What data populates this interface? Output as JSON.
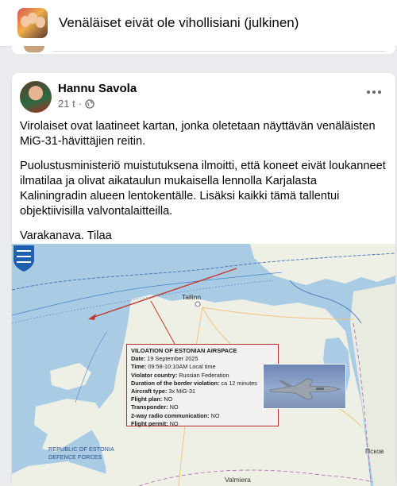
{
  "group": {
    "title": "Venäläiset eivät ole vihollisiani (julkinen)"
  },
  "post": {
    "author": "Hannu Savola",
    "time": "21 t",
    "visibility_separator": "·",
    "paragraphs": [
      "Virolaiset ovat laatineet kartan, jonka oletetaan näyttävän venäläisten MiG-31-hävittäjien reitin.",
      "Puolustusministeriö muistutuksena ilmoitti, että koneet eivät loukanneet ilmatilaa ja olivat aikataulun mukaisella lennolla Karjalasta Kaliningradin alueen lentokentälle. Lisäksi kaikki tämä tallentui objektiivisilla valvontalaitteilla.",
      "Varakanava. Tilaa"
    ]
  },
  "map": {
    "box": {
      "title": "VILOATION OF ESTONIAN AIRSPACE",
      "rows": [
        {
          "label": "Date:",
          "value": " 19 September 2025"
        },
        {
          "label": "Time:",
          "value": " 09:58-10:10AM Local time"
        },
        {
          "label": "Violator country:",
          "value": " Russian Federation"
        },
        {
          "label": "Duration of the border violation:",
          "value": " ca 12 minutes"
        },
        {
          "label": "Aircraft type:",
          "value": " 3x MiG-31"
        },
        {
          "label": "Flight plan:",
          "value": " NO"
        },
        {
          "label": "Transponder:",
          "value": " NO"
        },
        {
          "label": "2-way radio communication:",
          "value": " NO"
        },
        {
          "label": "Flight permit:",
          "value": " NO"
        }
      ]
    },
    "places": {
      "tallinn": "Tallinn",
      "pskov": "Псков",
      "valmiera": "Valmiera"
    },
    "logo_text": {
      "line1": "REPUBLIC OF ESTONIA",
      "line2": "DEFENCE FORCES"
    }
  },
  "icons": {
    "globe": "globe-icon",
    "more": "more-options-icon"
  },
  "colors": {
    "route": "#c0392b",
    "sea": "#a9cce4",
    "land": "#eef0e6"
  }
}
